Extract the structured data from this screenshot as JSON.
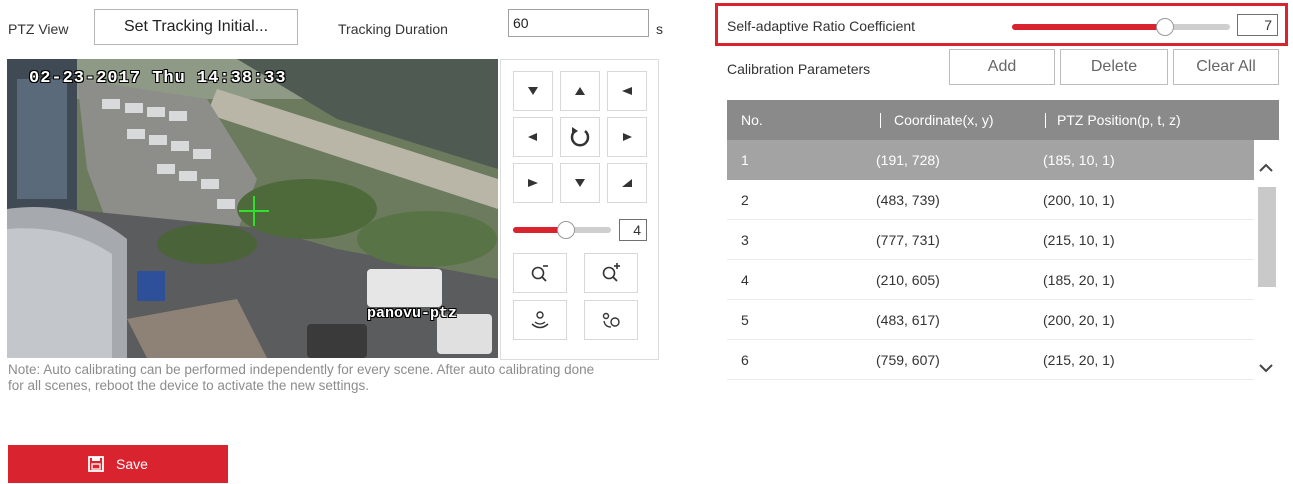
{
  "header": {
    "ptz_view_label": "PTZ View",
    "set_tracking_button": "Set Tracking Initial...",
    "tracking_duration_label": "Tracking Duration",
    "tracking_duration_value": "60",
    "tracking_duration_unit": "s"
  },
  "video": {
    "osd_timestamp": "02-23-2017 Thu 14:38:33",
    "osd_channel_name": "panovu-ptz"
  },
  "ptz_control": {
    "directions": [
      "up-left",
      "up",
      "up-right",
      "left",
      "auto",
      "right",
      "down-left",
      "down",
      "down-right"
    ],
    "speed_value": "4",
    "speed_level_fraction": 0.4,
    "icons": [
      "zoom-out-icon",
      "zoom-in-icon",
      "focus-near-icon",
      "focus-far-icon"
    ]
  },
  "note": "Note: Auto calibrating can be performed independently for every scene. After auto calibrating done for all scenes, reboot the device to activate the new settings.",
  "save_button": "Save",
  "self_adaptive": {
    "label": "Self-adaptive Ratio Coefficient",
    "value": "7",
    "level_fraction": 0.7
  },
  "calibration": {
    "label": "Calibration Parameters",
    "add_button": "Add",
    "delete_button": "Delete",
    "clear_all_button": "Clear All",
    "columns": [
      "No.",
      "Coordinate(x, y)",
      "PTZ Position(p, t, z)"
    ],
    "rows": [
      {
        "no": "1",
        "coord": "(191, 728)",
        "ptz": "(185, 10, 1)",
        "selected": true
      },
      {
        "no": "2",
        "coord": "(483, 739)",
        "ptz": "(200, 10, 1)",
        "selected": false
      },
      {
        "no": "3",
        "coord": "(777, 731)",
        "ptz": "(215, 10, 1)",
        "selected": false
      },
      {
        "no": "4",
        "coord": "(210, 605)",
        "ptz": "(185, 20, 1)",
        "selected": false
      },
      {
        "no": "5",
        "coord": "(483, 617)",
        "ptz": "(200, 20, 1)",
        "selected": false
      },
      {
        "no": "6",
        "coord": "(759, 607)",
        "ptz": "(215, 20, 1)",
        "selected": false
      }
    ]
  },
  "colors": {
    "accent": "#d9232e",
    "table_header": "#8a8a8a",
    "selected_row": "#a3a3a3"
  }
}
